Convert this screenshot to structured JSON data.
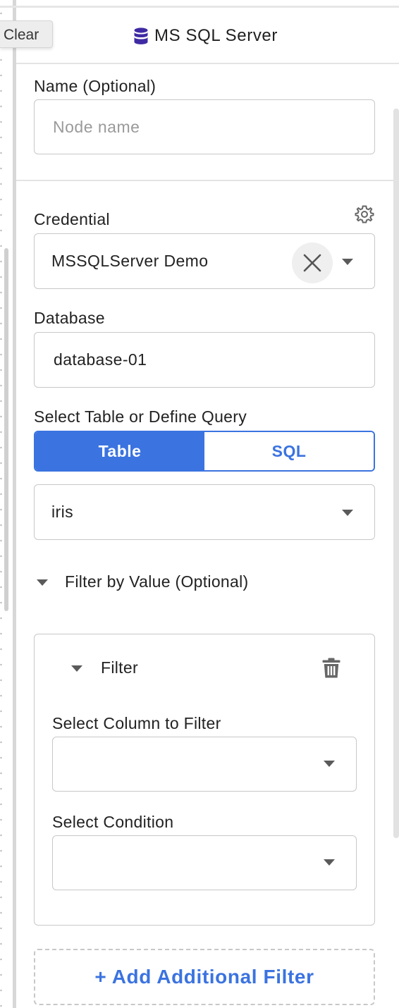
{
  "clear_button": {
    "label": "Clear"
  },
  "header": {
    "title": "MS SQL Server",
    "icon": "database-icon",
    "icon_color": "#3f2aa3"
  },
  "name_field": {
    "label": "Name (Optional)",
    "placeholder": "Node name",
    "value": ""
  },
  "credential": {
    "label": "Credential",
    "value": "MSSQLServer Demo",
    "settings_icon": "gear-icon",
    "clear_icon": "close-icon"
  },
  "database": {
    "label": "Database",
    "value": "database-01"
  },
  "source_mode": {
    "label": "Select Table or Define Query",
    "options": [
      "Table",
      "SQL"
    ],
    "selected": "Table"
  },
  "table_select": {
    "value": "iris"
  },
  "filter_section": {
    "label": "Filter by Value (Optional)",
    "expanded": true
  },
  "filter": {
    "title": "Filter",
    "delete_icon": "trash-icon",
    "column_label": "Select Column to Filter",
    "column_value": "",
    "condition_label": "Select Condition",
    "condition_value": ""
  },
  "add_filter": {
    "label": "+ Add Additional Filter"
  },
  "colors": {
    "accent": "#3b73e0",
    "border": "#c8c8c8",
    "text": "#222222"
  }
}
